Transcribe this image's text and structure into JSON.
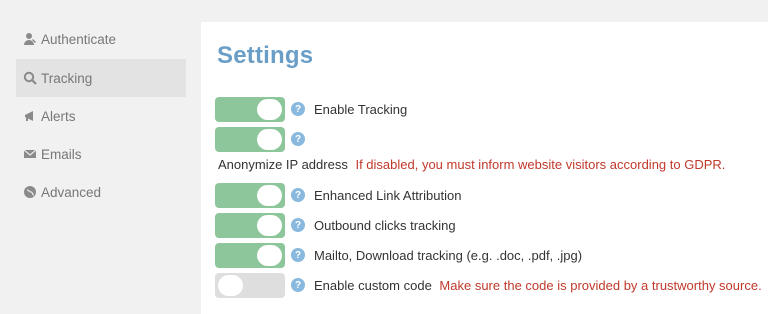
{
  "sidebar": {
    "items": [
      {
        "label": "Authenticate",
        "icon": "key-user-icon",
        "active": false
      },
      {
        "label": "Tracking",
        "icon": "magnifier-icon",
        "active": true
      },
      {
        "label": "Alerts",
        "icon": "megaphone-icon",
        "active": false
      },
      {
        "label": "Emails",
        "icon": "envelope-icon",
        "active": false
      },
      {
        "label": "Advanced",
        "icon": "globe-icon",
        "active": false
      }
    ]
  },
  "main": {
    "title": "Settings",
    "help_glyph": "?",
    "settings": [
      {
        "label": "Enable Tracking",
        "enabled": true
      },
      {
        "label": "",
        "enabled": true
      },
      {
        "label": "Enhanced Link Attribution",
        "enabled": true
      },
      {
        "label": "Outbound clicks tracking",
        "enabled": true
      },
      {
        "label": "Mailto, Download tracking (e.g. .doc, .pdf, .jpg)",
        "enabled": true
      },
      {
        "label": "Enable custom code",
        "warning": "Make sure the code is provided by a trustworthy source.",
        "enabled": false
      }
    ],
    "anonymize": {
      "label": "Anonymize IP address",
      "warning": "If disabled, you must inform website visitors according to GDPR."
    }
  },
  "colors": {
    "toggle_on": "#8cc69a",
    "toggle_off": "#dedede",
    "title": "#6a9ec7",
    "warning": "#c0392b",
    "help": "#89b9de"
  }
}
